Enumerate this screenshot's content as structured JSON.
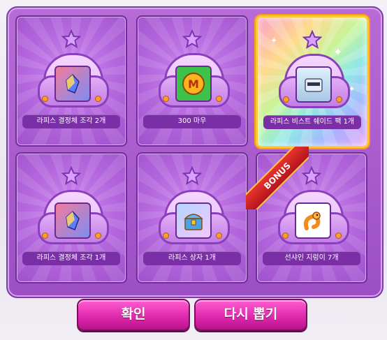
{
  "rewards": [
    {
      "label": "라피스 결정체 조각 2개",
      "icon": "crystal-shard-icon"
    },
    {
      "label": "300 마우",
      "icon": "meso-coin-icon"
    },
    {
      "label": "라피스 비스트 쉐이드 팩 1개",
      "icon": "shade-pack-icon",
      "highlight": true
    },
    {
      "label": "라피스 결정체 조각 1개",
      "icon": "crystal-shard-icon"
    },
    {
      "label": "라피스 상자 1개",
      "icon": "treasure-chest-icon"
    },
    {
      "label": "선샤인 지렁이 7개",
      "icon": "worm-icon"
    }
  ],
  "bonus_label": "BONUS",
  "buttons": {
    "confirm": "확인",
    "redraw": "다시 뽑기"
  },
  "colors": {
    "panel": "#a659cf",
    "button": "#e02aae",
    "highlight_border": "#ffcb33"
  }
}
